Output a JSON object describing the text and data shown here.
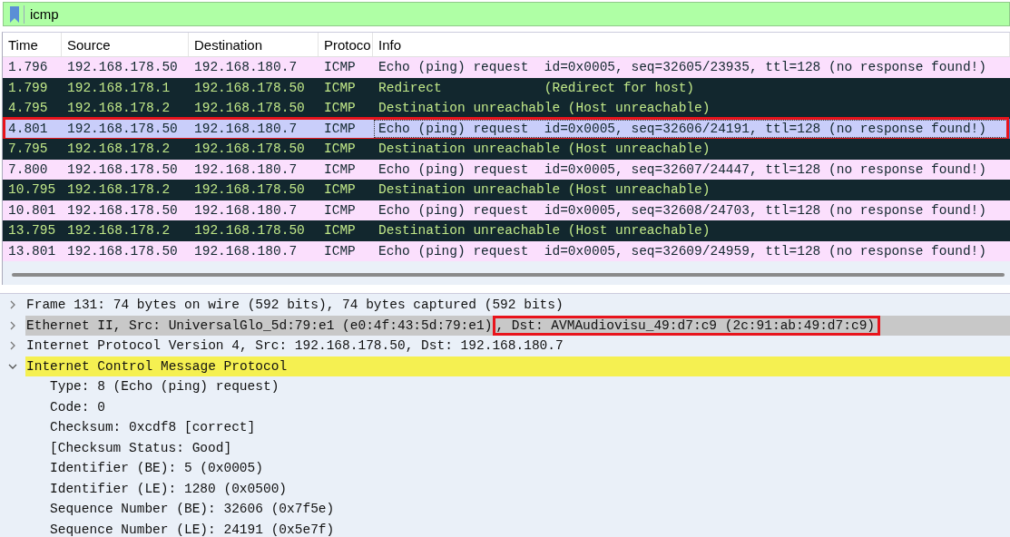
{
  "filter_bar": {
    "value": "icmp"
  },
  "packet_list": {
    "columns": [
      "Time",
      "Source",
      "Destination",
      "Protoco",
      "Info"
    ],
    "rows": [
      {
        "kind": "echo",
        "selected": false,
        "annotated": false,
        "cells": [
          "1.796",
          "192.168.178.50",
          "192.168.180.7",
          "ICMP",
          "Echo (ping) request  id=0x0005, seq=32605/23935, ttl=128 (no response found!)"
        ]
      },
      {
        "kind": "error",
        "selected": false,
        "annotated": false,
        "cells": [
          "1.799",
          "192.168.178.1",
          "192.168.178.50",
          "ICMP",
          "Redirect             (Redirect for host)"
        ]
      },
      {
        "kind": "error",
        "selected": false,
        "annotated": false,
        "cells": [
          "4.795",
          "192.168.178.2",
          "192.168.178.50",
          "ICMP",
          "Destination unreachable (Host unreachable)"
        ]
      },
      {
        "kind": "echo",
        "selected": true,
        "annotated": true,
        "cells": [
          "4.801",
          "192.168.178.50",
          "192.168.180.7",
          "ICMP",
          "Echo (ping) request  id=0x0005, seq=32606/24191, ttl=128 (no response found!)"
        ]
      },
      {
        "kind": "error",
        "selected": false,
        "annotated": false,
        "cells": [
          "7.795",
          "192.168.178.2",
          "192.168.178.50",
          "ICMP",
          "Destination unreachable (Host unreachable)"
        ]
      },
      {
        "kind": "echo",
        "selected": false,
        "annotated": false,
        "cells": [
          "7.800",
          "192.168.178.50",
          "192.168.180.7",
          "ICMP",
          "Echo (ping) request  id=0x0005, seq=32607/24447, ttl=128 (no response found!)"
        ]
      },
      {
        "kind": "error",
        "selected": false,
        "annotated": false,
        "cells": [
          "10.795",
          "192.168.178.2",
          "192.168.178.50",
          "ICMP",
          "Destination unreachable (Host unreachable)"
        ]
      },
      {
        "kind": "echo",
        "selected": false,
        "annotated": false,
        "cells": [
          "10.801",
          "192.168.178.50",
          "192.168.180.7",
          "ICMP",
          "Echo (ping) request  id=0x0005, seq=32608/24703, ttl=128 (no response found!)"
        ]
      },
      {
        "kind": "error",
        "selected": false,
        "annotated": false,
        "cells": [
          "13.795",
          "192.168.178.2",
          "192.168.178.50",
          "ICMP",
          "Destination unreachable (Host unreachable)"
        ]
      },
      {
        "kind": "echo",
        "selected": false,
        "annotated": false,
        "cells": [
          "13.801",
          "192.168.178.50",
          "192.168.180.7",
          "ICMP",
          "Echo (ping) request  id=0x0005, seq=32609/24959, ttl=128 (no response found!)"
        ]
      }
    ]
  },
  "packet_details": [
    {
      "text": "Frame 131: 74 bytes on wire (592 bits), 74 bytes captured (592 bits)",
      "expanded": false,
      "selected": false,
      "hovered": false
    },
    {
      "text": "Ethernet II, Src: UniversalGlo_5d:79:e1 (e0:4f:43:5d:79:e1)",
      "annotated_text": ", Dst: AVMAudiovisu_49:d7:c9 (2c:91:ab:49:d7:c9)",
      "expanded": false,
      "selected": false,
      "hovered": true
    },
    {
      "text": "Internet Protocol Version 4, Src: 192.168.178.50, Dst: 192.168.180.7",
      "expanded": false,
      "selected": false,
      "hovered": false
    },
    {
      "text": "Internet Control Message Protocol",
      "expanded": true,
      "selected": true,
      "hovered": false,
      "children": [
        {
          "text": "Type: 8 (Echo (ping) request)"
        },
        {
          "text": "Code: 0"
        },
        {
          "text": "Checksum: 0xcdf8 [correct]"
        },
        {
          "text": "[Checksum Status: Good]"
        },
        {
          "text": "Identifier (BE): 5 (0x0005)"
        },
        {
          "text": "Identifier (LE): 1280 (0x0500)"
        },
        {
          "text": "Sequence Number (BE): 32606 (0x7f5e)"
        },
        {
          "text": "Sequence Number (LE): 24191 (0x5e7f)"
        }
      ]
    }
  ]
}
